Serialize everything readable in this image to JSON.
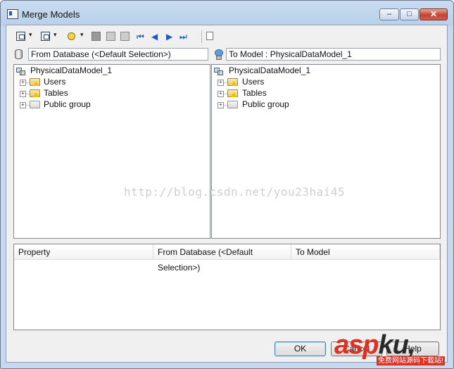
{
  "window": {
    "title": "Merge Models",
    "min_label": "–",
    "max_label": "□",
    "close_label": "✕"
  },
  "toolbar": {
    "icons": [
      "select-all-icon",
      "dropdown-arrow",
      "select-filter-icon",
      "dropdown-arrow",
      "lightbulb-icon",
      "dropdown-arrow",
      "merge-item-icon",
      "apply-icon",
      "compare-icon",
      "first-icon",
      "previous-icon",
      "next-icon",
      "last-icon",
      "properties-icon"
    ],
    "nav": {
      "first": "⏮",
      "prev": "◀",
      "next": "▶",
      "last": "⏭"
    }
  },
  "left_pane": {
    "header": "From Database (<Default Selection>)",
    "root": "PhysicalDataModel_1",
    "items": [
      {
        "label": "Users",
        "icon": "folder-warning-icon"
      },
      {
        "label": "Tables",
        "icon": "folder-warning-icon"
      },
      {
        "label": "Public group",
        "icon": "folder-icon"
      }
    ]
  },
  "right_pane": {
    "header": "To Model : PhysicalDataModel_1",
    "root": "PhysicalDataModel_1",
    "items": [
      {
        "label": "Users",
        "icon": "folder-warning-icon"
      },
      {
        "label": "Tables",
        "icon": "folder-warning-icon"
      },
      {
        "label": "Public group",
        "icon": "folder-icon"
      }
    ]
  },
  "properties": {
    "columns": [
      "Property",
      "From Database (<Default Selection>)",
      "To Model"
    ]
  },
  "watermark": "http://blog.csdn.net/you23hai45",
  "buttons": {
    "ok": "OK",
    "cancel": "Cancel",
    "help": "Help"
  },
  "brand": {
    "logo_text_1": "asp",
    "logo_text_2": "ku",
    "logo_dot": ",",
    "tagline": "免费网站源码下载站!"
  }
}
